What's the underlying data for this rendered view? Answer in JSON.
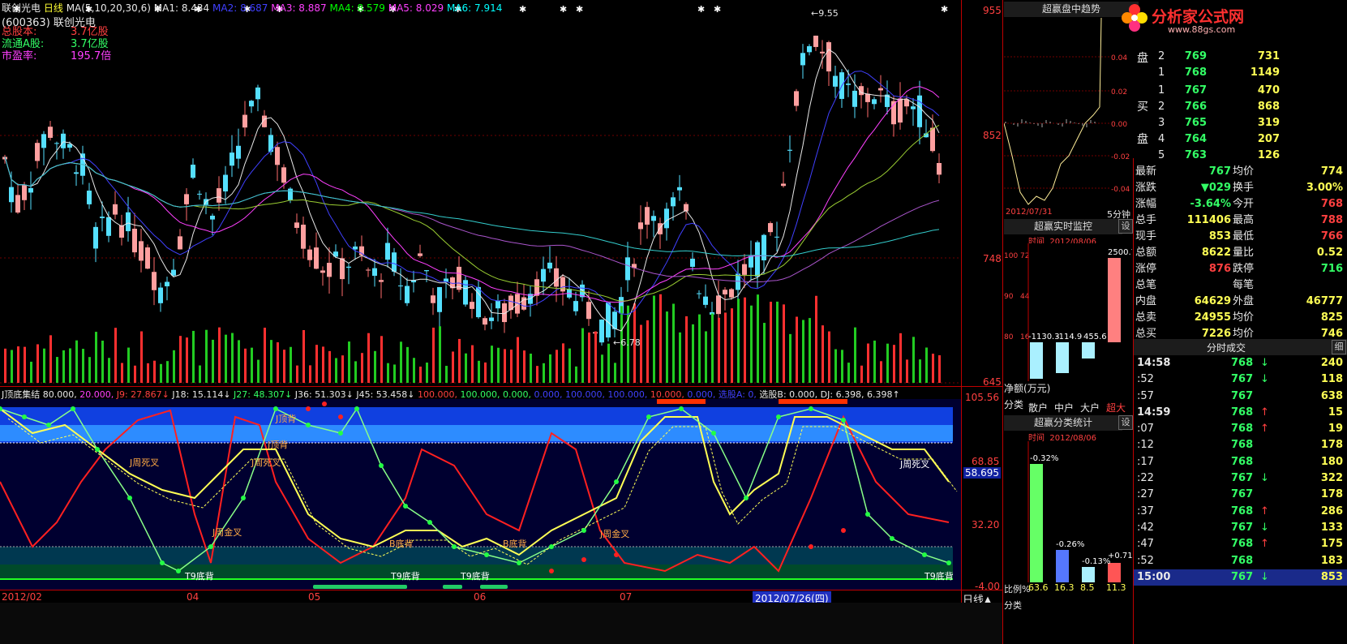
{
  "header": {
    "code": "(600363)",
    "name": "联创光电",
    "period": "日线",
    "ma_label": "MA(5,10,20,30,6)",
    "ma_items": [
      {
        "label": "MA1:",
        "value": "8.434",
        "color": "#e8e8e8"
      },
      {
        "label": "MA2:",
        "value": "8.687",
        "color": "#4040ff"
      },
      {
        "label": "MA3:",
        "value": "8.887",
        "color": "#ff40ff"
      },
      {
        "label": "MA4:",
        "value": "8.579",
        "color": "#00ff00"
      },
      {
        "label": "MA5:",
        "value": "8.029",
        "color": "#ff40ff"
      },
      {
        "label": "MA6:",
        "value": "7.914",
        "color": "#00ffff"
      }
    ]
  },
  "info": [
    {
      "label": "总股本:",
      "value": "3.7亿股",
      "color": "#ff4040"
    },
    {
      "label": "流通A股:",
      "value": "3.7亿股",
      "color": "#33ff66"
    },
    {
      "label": "市盈率:",
      "value": "195.7倍",
      "color": "#ff40ff"
    }
  ],
  "price_axis": [
    "955",
    "852",
    "748",
    "645"
  ],
  "price_marks": {
    "high": "9.55",
    "low": "6.78"
  },
  "indicator": {
    "title": "J顶底集结",
    "values": [
      {
        "text": "80.000,",
        "color": "#e8e8e8"
      },
      {
        "text": "20.000,",
        "color": "#ff40ff"
      },
      {
        "text": "J9: 27.867↓",
        "color": "#ff4040"
      },
      {
        "text": "J18: 15.114↓",
        "color": "#e8e8e8"
      },
      {
        "text": "J27: 48.307↓",
        "color": "#33ff66"
      },
      {
        "text": "J36: 51.303↓",
        "color": "#e8e8e8"
      },
      {
        "text": "J45: 53.458↓",
        "color": "#e8e8e8"
      },
      {
        "text": "100.000,",
        "color": "#ff4040"
      },
      {
        "text": "100.000,",
        "color": "#33ff66"
      },
      {
        "text": "0.000,",
        "color": "#33ff66"
      },
      {
        "text": "0.000,",
        "color": "#4040ff"
      },
      {
        "text": "100.000,",
        "color": "#4040ff"
      },
      {
        "text": "100.000,",
        "color": "#4040ff"
      },
      {
        "text": "10.000,",
        "color": "#ff4040"
      },
      {
        "text": "0.000,",
        "color": "#4040ff"
      },
      {
        "text": "选股A: 0,",
        "color": "#4040ff"
      },
      {
        "text": "选股B: 0.000,",
        "color": "#e8e8e8"
      },
      {
        "text": "DJ: 6.398,",
        "color": "#e8e8e8"
      },
      {
        "text": "6.398↑",
        "color": "#e8e8e8"
      }
    ],
    "axis": [
      "105.56",
      "68.85",
      "32.20",
      "-4.00"
    ],
    "current": "58.695",
    "labels": [
      {
        "text": "J顶背"
      },
      {
        "text": "J顶背"
      },
      {
        "text": "J周死叉"
      },
      {
        "text": "J周死叉"
      },
      {
        "text": "J周金叉"
      },
      {
        "text": "B底背"
      },
      {
        "text": "B底背"
      },
      {
        "text": "J周金叉"
      },
      {
        "text": "T9底背"
      },
      {
        "text": "T9底背"
      },
      {
        "text": "T9底背"
      },
      {
        "text": "T9底背"
      },
      {
        "text": "J周死叉"
      }
    ]
  },
  "date_axis": {
    "labels": [
      "2012/02",
      "04",
      "05",
      "06",
      "07"
    ],
    "cursor_date": "2012/07/26(四)",
    "period_btn": "日线▲"
  },
  "right_panel": {
    "logo": {
      "name": "分析家公式网",
      "url": "www.88gs.com"
    },
    "trend_title": "超赢盘中趋势",
    "trend_pct": [
      "0.04",
      "0.02",
      "0.00",
      "-0.02",
      "-0.04"
    ],
    "trend_date": "2012/07/31",
    "five_min": "5分钟",
    "monitor_title": "超赢实时监控",
    "set_label": "设",
    "monitor_time_label": "时间",
    "monitor_time": "2012/08/06",
    "monitor_left_axis": [
      "100",
      "90",
      "80"
    ],
    "monitor_left_vals": [
      "72",
      "44",
      "16"
    ],
    "monitor_vals": [
      "-1130.3",
      "-114.9",
      "455.6",
      "2500.7"
    ],
    "net_label": "净额(万元)",
    "class_label": "分类",
    "classes": [
      "散户",
      "中户",
      "大户",
      "超大"
    ],
    "stats_title": "超赢分类统计",
    "stats_time_label": "时间",
    "stats_time": "2012/08/06",
    "stats_pcts": [
      "-0.32%",
      "-0.26%",
      "-0.13%",
      "+0.71%"
    ],
    "ratio_label": "比例%",
    "ratio_vals": [
      "63.6",
      "16.3",
      "8.5",
      "11.3"
    ],
    "class_label2": "分类"
  },
  "quotes": {
    "sell_label": [
      "盘"
    ],
    "buy_label": [
      "买",
      "盘"
    ],
    "sell_rows": [
      {
        "n": "2",
        "price": "769",
        "vol": "731"
      },
      {
        "n": "1",
        "price": "768",
        "vol": "1149"
      }
    ],
    "buy_rows": [
      {
        "n": "1",
        "price": "767",
        "vol": "470"
      },
      {
        "n": "2",
        "price": "766",
        "vol": "868"
      },
      {
        "n": "3",
        "price": "765",
        "vol": "319"
      },
      {
        "n": "4",
        "price": "764",
        "vol": "207"
      },
      {
        "n": "5",
        "price": "763",
        "vol": "126"
      }
    ],
    "stats": [
      {
        "l": "最新",
        "lv": "767",
        "r": "均价",
        "rv": "774"
      },
      {
        "l": "涨跌",
        "lv": "▼029",
        "r": "换手",
        "rv": "3.00%"
      },
      {
        "l": "涨幅",
        "lv": "-3.64%",
        "r": "今开",
        "rv": "768"
      },
      {
        "l": "总手",
        "lv": "111406",
        "r": "最高",
        "rv": "788"
      },
      {
        "l": "现手",
        "lv": "853",
        "r": "最低",
        "rv": "766"
      },
      {
        "l": "总额",
        "lv": "8622",
        "r": "量比",
        "rv": "0.52"
      },
      {
        "l": "涨停",
        "lv": "876",
        "r": "跌停",
        "rv": "716"
      },
      {
        "l": "总笔",
        "lv": "",
        "r": "每笔",
        "rv": ""
      },
      {
        "l": "内盘",
        "lv": "64629",
        "r": "外盘",
        "rv": "46777"
      },
      {
        "l": "总卖",
        "lv": "24955",
        "r": "均价",
        "rv": "825"
      },
      {
        "l": "总买",
        "lv": "7226",
        "r": "均价",
        "rv": "746"
      }
    ],
    "ticks_title": "分时成交",
    "ticks_btn": "细",
    "ticks": [
      {
        "t": "14:58",
        "p": "768",
        "a": "↓",
        "v": "240"
      },
      {
        "t": ":52",
        "p": "767",
        "a": "↓",
        "v": "118"
      },
      {
        "t": ":57",
        "p": "767",
        "a": "",
        "v": "638"
      },
      {
        "t": "14:59",
        "p": "768",
        "a": "↑",
        "v": "15"
      },
      {
        "t": ":07",
        "p": "768",
        "a": "↑",
        "v": "19"
      },
      {
        "t": ":12",
        "p": "768",
        "a": "",
        "v": "178"
      },
      {
        "t": ":17",
        "p": "768",
        "a": "",
        "v": "180"
      },
      {
        "t": ":22",
        "p": "767",
        "a": "↓",
        "v": "322"
      },
      {
        "t": ":27",
        "p": "767",
        "a": "",
        "v": "178"
      },
      {
        "t": ":37",
        "p": "768",
        "a": "↑",
        "v": "286"
      },
      {
        "t": ":42",
        "p": "767",
        "a": "↓",
        "v": "133"
      },
      {
        "t": ":47",
        "p": "768",
        "a": "↑",
        "v": "175"
      },
      {
        "t": ":52",
        "p": "768",
        "a": "",
        "v": "183"
      },
      {
        "t": "15:00",
        "p": "767",
        "a": "↓",
        "v": "853"
      }
    ]
  }
}
